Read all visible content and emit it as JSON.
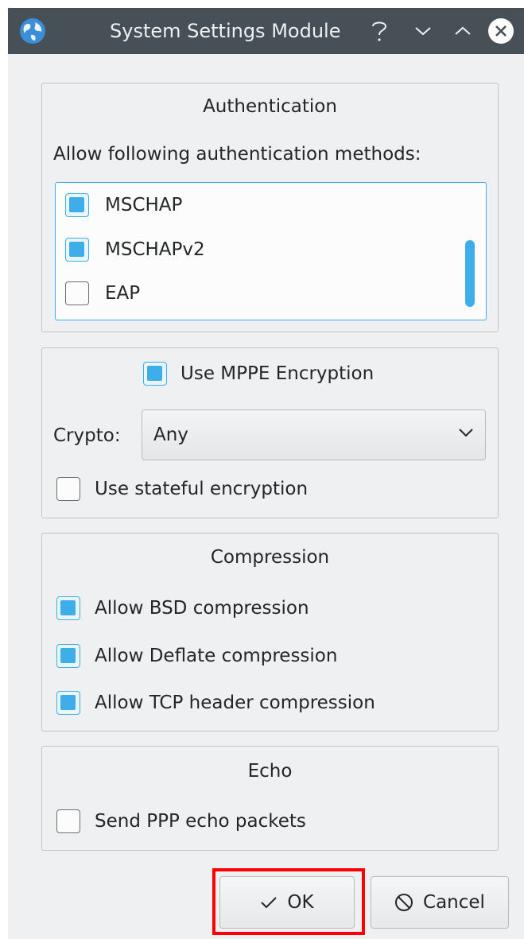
{
  "window": {
    "title": "System Settings Module",
    "app_icon": "globe-icon",
    "controls": [
      "help-icon",
      "minimize-icon",
      "maximize-icon",
      "close-icon"
    ]
  },
  "authentication": {
    "title": "Authentication",
    "prompt": "Allow following authentication methods:",
    "methods": [
      {
        "label": "MSCHAP",
        "checked": true
      },
      {
        "label": "MSCHAPv2",
        "checked": true
      },
      {
        "label": "EAP",
        "checked": false
      }
    ]
  },
  "encryption": {
    "use_mppe_label": "Use MPPE Encryption",
    "use_mppe_checked": true,
    "crypto_label": "Crypto:",
    "crypto_value": "Any",
    "stateful_label": "Use stateful encryption",
    "stateful_checked": false
  },
  "compression": {
    "title": "Compression",
    "options": [
      {
        "label": "Allow BSD compression",
        "checked": true
      },
      {
        "label": "Allow Deflate compression",
        "checked": true
      },
      {
        "label": "Allow TCP header compression",
        "checked": true
      }
    ]
  },
  "echo": {
    "title": "Echo",
    "send_label": "Send PPP echo packets",
    "send_checked": false
  },
  "buttons": {
    "ok_label": "OK",
    "cancel_label": "Cancel"
  },
  "colors": {
    "accent": "#3daee9",
    "titlebar": "#475057",
    "window_bg": "#eff0f1",
    "highlight": "#ff0000"
  }
}
